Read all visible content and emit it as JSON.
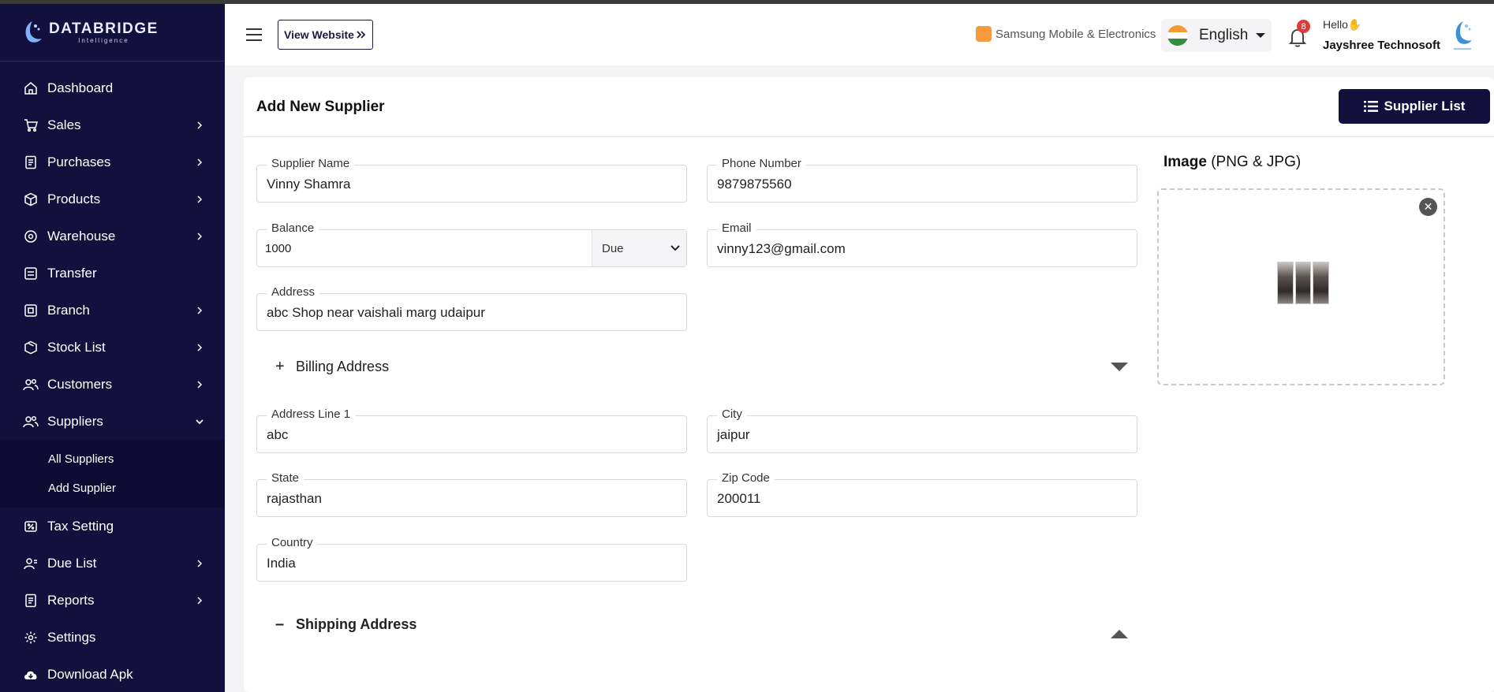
{
  "brand": {
    "name": "DATABRIDGE",
    "tagline": "Intelligence"
  },
  "sidebar": {
    "items": [
      {
        "label": "Dashboard",
        "icon": "home-icon",
        "chevron": false
      },
      {
        "label": "Sales",
        "icon": "cart-icon",
        "chevron": true
      },
      {
        "label": "Purchases",
        "icon": "receipt-icon",
        "chevron": true
      },
      {
        "label": "Products",
        "icon": "box-icon",
        "chevron": true
      },
      {
        "label": "Warehouse",
        "icon": "warehouse-icon",
        "chevron": true
      },
      {
        "label": "Transfer",
        "icon": "transfer-icon",
        "chevron": false
      },
      {
        "label": "Branch",
        "icon": "branch-icon",
        "chevron": true
      },
      {
        "label": "Stock List",
        "icon": "stock-icon",
        "chevron": true
      },
      {
        "label": "Customers",
        "icon": "customers-icon",
        "chevron": true
      },
      {
        "label": "Suppliers",
        "icon": "suppliers-icon",
        "chevron": true,
        "expanded": true
      },
      {
        "label": "Tax Setting",
        "icon": "tax-icon",
        "chevron": false
      },
      {
        "label": "Due List",
        "icon": "due-icon",
        "chevron": true
      },
      {
        "label": "Reports",
        "icon": "reports-icon",
        "chevron": true
      },
      {
        "label": "Settings",
        "icon": "gear-icon",
        "chevron": false
      },
      {
        "label": "Download Apk",
        "icon": "cloud-download-icon",
        "chevron": false
      }
    ],
    "suppliers_sub": [
      "All Suppliers",
      "Add Supplier"
    ]
  },
  "header": {
    "view_website": "View Website",
    "store": "Samsung Mobile & Electronics",
    "language": "English",
    "notifications": "8",
    "greeting": "Hello✋",
    "user": "Jayshree Technosoft"
  },
  "page": {
    "title": "Add New Supplier",
    "supplier_list_btn": "Supplier List"
  },
  "form": {
    "supplier_name": {
      "label": "Supplier Name",
      "value": "Vinny Shamra"
    },
    "phone": {
      "label": "Phone Number",
      "value": "9879875560"
    },
    "balance": {
      "label": "Balance",
      "value": "1000",
      "type": "Due"
    },
    "email": {
      "label": "Email",
      "value": "vinny123@gmail.com"
    },
    "address": {
      "label": "Address",
      "value": "abc Shop near vaishali marg udaipur"
    },
    "billing_title": "Billing Address",
    "address_line1": {
      "label": "Address Line 1",
      "value": "abc"
    },
    "city": {
      "label": "City",
      "value": "jaipur"
    },
    "state": {
      "label": "State",
      "value": "rajasthan"
    },
    "zip": {
      "label": "Zip Code",
      "value": "200011"
    },
    "country": {
      "label": "Country",
      "value": "India"
    },
    "shipping_title": "Shipping Address",
    "image_title": "Image",
    "image_hint": "(PNG & JPG)"
  }
}
